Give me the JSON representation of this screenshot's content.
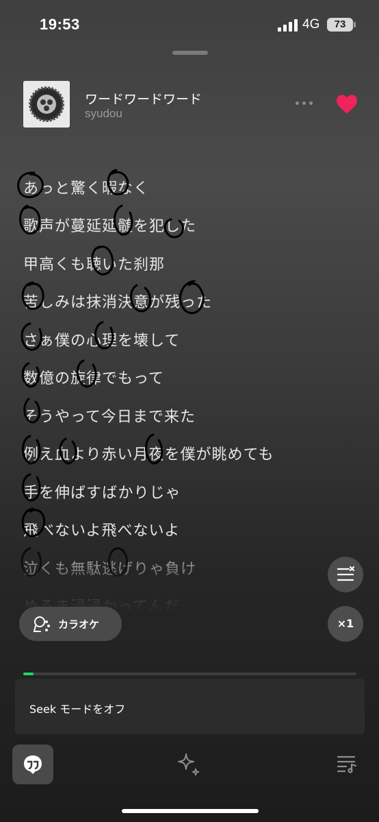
{
  "status_bar": {
    "time": "19:53",
    "network": "4G",
    "battery": "73"
  },
  "track": {
    "title": "ワードワードワード",
    "artist": "syudou",
    "liked": true
  },
  "lyrics": [
    "あっと驚く暇なく",
    "歌声が蔓延延髄を犯した",
    "甲高くも聴いた刹那",
    "苦しみは抹消決意が残った",
    "さぁ僕の心理を壊して",
    "数億の旋律でもって",
    "そうやって今日まで来た",
    "例え血より赤い月夜を僕が眺めても",
    "手を伸ばすばかりじゃ",
    "飛べないよ飛べないよ",
    "泣くも無駄逃げりゃ負け",
    "めるま浸浸かってんだ"
  ],
  "controls": {
    "karaoke_label": "カラオケ",
    "speed_label": "×1",
    "seek_mode_label": "Seek モードをオフ",
    "progress": 0.03
  },
  "icons": {
    "heart": "heart-icon",
    "more": "more-icon",
    "karaoke": "microphone-icon",
    "queue_clear": "queue-clear-icon",
    "lyrics_tab": "lyrics-icon",
    "ai": "sparkle-icon",
    "queue": "queue-music-icon"
  },
  "colors": {
    "accent": "#1ed760",
    "heart": "#f0245a"
  }
}
